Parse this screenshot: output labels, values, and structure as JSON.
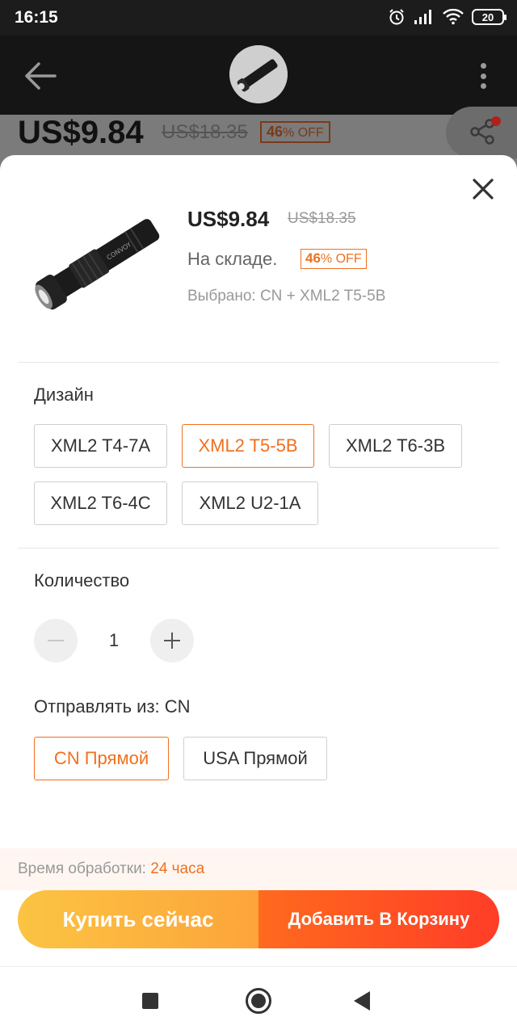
{
  "status_bar": {
    "time": "16:15",
    "battery": "20"
  },
  "background_page": {
    "price": "US$9.84",
    "old_price": "US$18.35",
    "discount_number": "46",
    "discount_suffix": "% OFF"
  },
  "sheet": {
    "price": "US$9.84",
    "old_price": "US$18.35",
    "stock_status": "На складе.",
    "discount_number": "46",
    "discount_suffix": "% OFF",
    "selected_text": "Выбрано: CN + XML2 T5-5B",
    "design": {
      "label": "Дизайн",
      "options": [
        "XML2 T4-7A",
        "XML2 T5-5B",
        "XML2 T6-3B",
        "XML2 T6-4C",
        "XML2 U2-1A"
      ],
      "selected": "XML2 T5-5B"
    },
    "quantity": {
      "label": "Количество",
      "value": "1"
    },
    "ship_from": {
      "label": "Отправлять из: CN",
      "options": [
        "CN Прямой",
        "USA Прямой"
      ],
      "selected": "CN Прямой"
    },
    "processing": {
      "label": "Время обработки: ",
      "value": "24 часа"
    },
    "buy_now_label": "Купить сейчас",
    "add_to_cart_label": "Добавить В Корзину"
  },
  "colors": {
    "accent": "#f07020",
    "buy_now": "#fbc443",
    "add_to_cart": "#ff4a24"
  }
}
